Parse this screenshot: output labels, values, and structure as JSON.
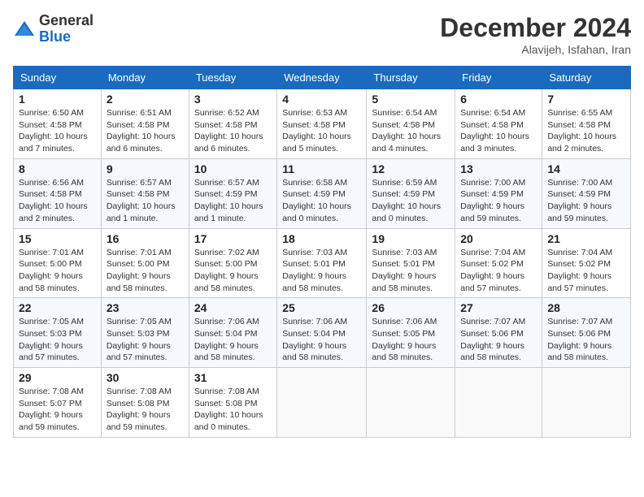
{
  "logo": {
    "general": "General",
    "blue": "Blue"
  },
  "title": "December 2024",
  "subtitle": "Alavijeh, Isfahan, Iran",
  "days_header": [
    "Sunday",
    "Monday",
    "Tuesday",
    "Wednesday",
    "Thursday",
    "Friday",
    "Saturday"
  ],
  "weeks": [
    [
      {
        "day": "1",
        "sunrise": "6:50 AM",
        "sunset": "4:58 PM",
        "daylight": "10 hours and 7 minutes."
      },
      {
        "day": "2",
        "sunrise": "6:51 AM",
        "sunset": "4:58 PM",
        "daylight": "10 hours and 6 minutes."
      },
      {
        "day": "3",
        "sunrise": "6:52 AM",
        "sunset": "4:58 PM",
        "daylight": "10 hours and 6 minutes."
      },
      {
        "day": "4",
        "sunrise": "6:53 AM",
        "sunset": "4:58 PM",
        "daylight": "10 hours and 5 minutes."
      },
      {
        "day": "5",
        "sunrise": "6:54 AM",
        "sunset": "4:58 PM",
        "daylight": "10 hours and 4 minutes."
      },
      {
        "day": "6",
        "sunrise": "6:54 AM",
        "sunset": "4:58 PM",
        "daylight": "10 hours and 3 minutes."
      },
      {
        "day": "7",
        "sunrise": "6:55 AM",
        "sunset": "4:58 PM",
        "daylight": "10 hours and 2 minutes."
      }
    ],
    [
      {
        "day": "8",
        "sunrise": "6:56 AM",
        "sunset": "4:58 PM",
        "daylight": "10 hours and 2 minutes."
      },
      {
        "day": "9",
        "sunrise": "6:57 AM",
        "sunset": "4:58 PM",
        "daylight": "10 hours and 1 minute."
      },
      {
        "day": "10",
        "sunrise": "6:57 AM",
        "sunset": "4:59 PM",
        "daylight": "10 hours and 1 minute."
      },
      {
        "day": "11",
        "sunrise": "6:58 AM",
        "sunset": "4:59 PM",
        "daylight": "10 hours and 0 minutes."
      },
      {
        "day": "12",
        "sunrise": "6:59 AM",
        "sunset": "4:59 PM",
        "daylight": "10 hours and 0 minutes."
      },
      {
        "day": "13",
        "sunrise": "7:00 AM",
        "sunset": "4:59 PM",
        "daylight": "9 hours and 59 minutes."
      },
      {
        "day": "14",
        "sunrise": "7:00 AM",
        "sunset": "4:59 PM",
        "daylight": "9 hours and 59 minutes."
      }
    ],
    [
      {
        "day": "15",
        "sunrise": "7:01 AM",
        "sunset": "5:00 PM",
        "daylight": "9 hours and 58 minutes."
      },
      {
        "day": "16",
        "sunrise": "7:01 AM",
        "sunset": "5:00 PM",
        "daylight": "9 hours and 58 minutes."
      },
      {
        "day": "17",
        "sunrise": "7:02 AM",
        "sunset": "5:00 PM",
        "daylight": "9 hours and 58 minutes."
      },
      {
        "day": "18",
        "sunrise": "7:03 AM",
        "sunset": "5:01 PM",
        "daylight": "9 hours and 58 minutes."
      },
      {
        "day": "19",
        "sunrise": "7:03 AM",
        "sunset": "5:01 PM",
        "daylight": "9 hours and 58 minutes."
      },
      {
        "day": "20",
        "sunrise": "7:04 AM",
        "sunset": "5:02 PM",
        "daylight": "9 hours and 57 minutes."
      },
      {
        "day": "21",
        "sunrise": "7:04 AM",
        "sunset": "5:02 PM",
        "daylight": "9 hours and 57 minutes."
      }
    ],
    [
      {
        "day": "22",
        "sunrise": "7:05 AM",
        "sunset": "5:03 PM",
        "daylight": "9 hours and 57 minutes."
      },
      {
        "day": "23",
        "sunrise": "7:05 AM",
        "sunset": "5:03 PM",
        "daylight": "9 hours and 57 minutes."
      },
      {
        "day": "24",
        "sunrise": "7:06 AM",
        "sunset": "5:04 PM",
        "daylight": "9 hours and 58 minutes."
      },
      {
        "day": "25",
        "sunrise": "7:06 AM",
        "sunset": "5:04 PM",
        "daylight": "9 hours and 58 minutes."
      },
      {
        "day": "26",
        "sunrise": "7:06 AM",
        "sunset": "5:05 PM",
        "daylight": "9 hours and 58 minutes."
      },
      {
        "day": "27",
        "sunrise": "7:07 AM",
        "sunset": "5:06 PM",
        "daylight": "9 hours and 58 minutes."
      },
      {
        "day": "28",
        "sunrise": "7:07 AM",
        "sunset": "5:06 PM",
        "daylight": "9 hours and 58 minutes."
      }
    ],
    [
      {
        "day": "29",
        "sunrise": "7:08 AM",
        "sunset": "5:07 PM",
        "daylight": "9 hours and 59 minutes."
      },
      {
        "day": "30",
        "sunrise": "7:08 AM",
        "sunset": "5:08 PM",
        "daylight": "9 hours and 59 minutes."
      },
      {
        "day": "31",
        "sunrise": "7:08 AM",
        "sunset": "5:08 PM",
        "daylight": "10 hours and 0 minutes."
      },
      null,
      null,
      null,
      null
    ]
  ]
}
